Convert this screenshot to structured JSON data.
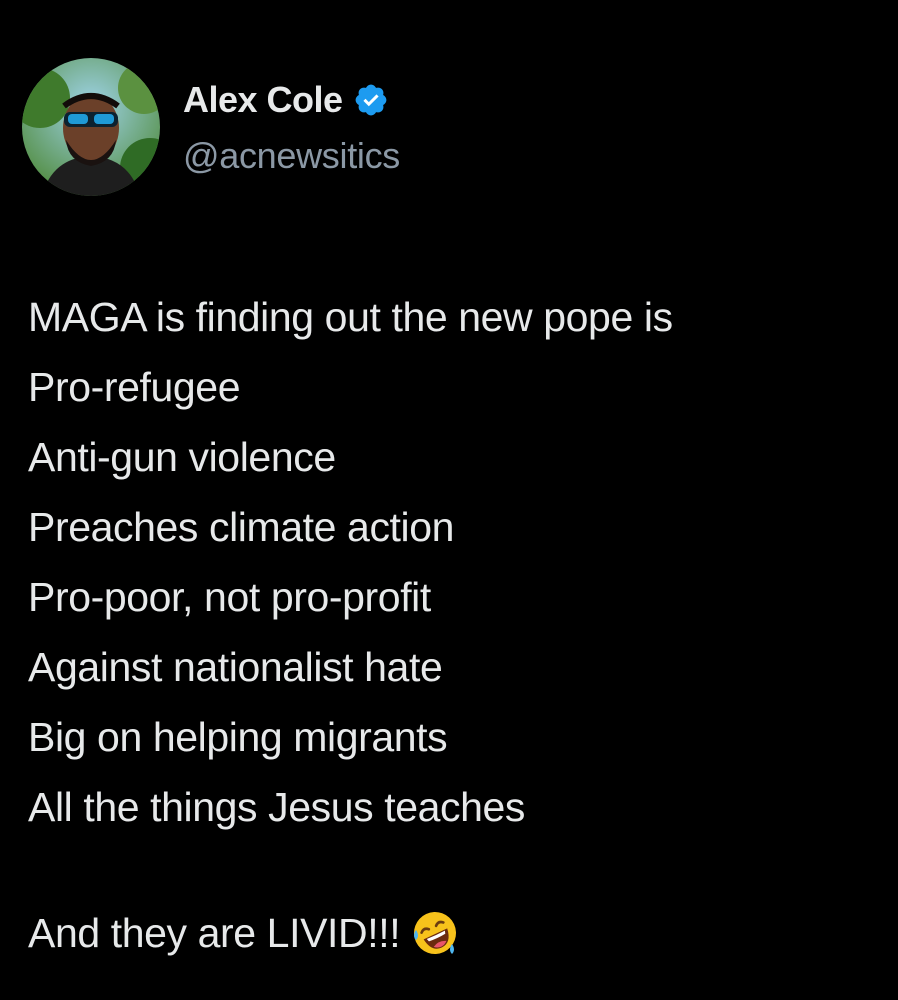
{
  "author": {
    "display_name": "Alex Cole",
    "handle": "@acnewsitics",
    "verified": true,
    "avatar_icon": "profile-photo-icon",
    "badge_icon": "verified-badge-icon"
  },
  "tweet": {
    "lines": [
      "MAGA is finding out the new pope is",
      "Pro-refugee",
      "Anti-gun violence",
      "Preaches climate action",
      "Pro-poor, not pro-profit",
      "Against nationalist hate",
      "Big on helping migrants",
      "All the things Jesus teaches"
    ],
    "closing": "And they are LIVID!!!",
    "closing_emoji": "rolling-on-floor-laughing-emoji"
  },
  "colors": {
    "background": "#000000",
    "text": "#e7e9ea",
    "handle": "#8b98a5",
    "verified": "#1d9bf0"
  }
}
